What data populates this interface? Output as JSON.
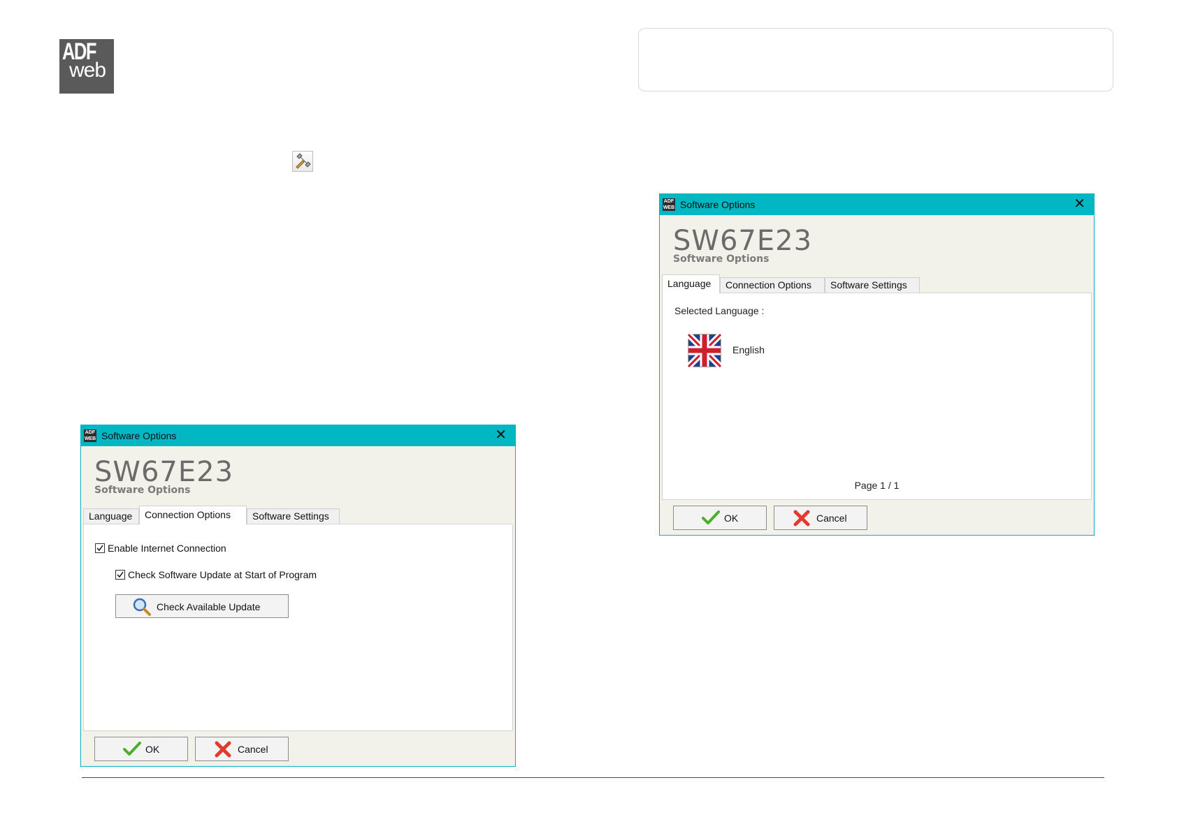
{
  "logo": {
    "line1": "ADF",
    "line2": "web"
  },
  "dialog_connection": {
    "window_title": "Software Options",
    "heading": "SW67E23",
    "subheading": "Software Options",
    "tabs": [
      {
        "label": "Language",
        "active": false
      },
      {
        "label": "Connection Options",
        "active": true
      },
      {
        "label": "Software Settings",
        "active": false
      }
    ],
    "enable_internet": {
      "label": "Enable Internet Connection",
      "checked": true
    },
    "check_update_start": {
      "label": "Check Software Update at Start of Program",
      "checked": true
    },
    "check_update_button": "Check Available Update",
    "ok_label": "OK",
    "cancel_label": "Cancel"
  },
  "dialog_language": {
    "window_title": "Software Options",
    "heading": "SW67E23",
    "subheading": "Software Options",
    "tabs": [
      {
        "label": "Language",
        "active": true
      },
      {
        "label": "Connection Options",
        "active": false
      },
      {
        "label": "Software Settings",
        "active": false
      }
    ],
    "selected_language_label": "Selected Language :",
    "language_name": "English",
    "language_flag_icon": "uk-flag-icon",
    "page_indicator": "Page 1 / 1",
    "ok_label": "OK",
    "cancel_label": "Cancel"
  },
  "colors": {
    "titlebar": "#00b7c3",
    "dialog_background": "#f3f2ea",
    "footer_line": "#2f4a7a"
  }
}
